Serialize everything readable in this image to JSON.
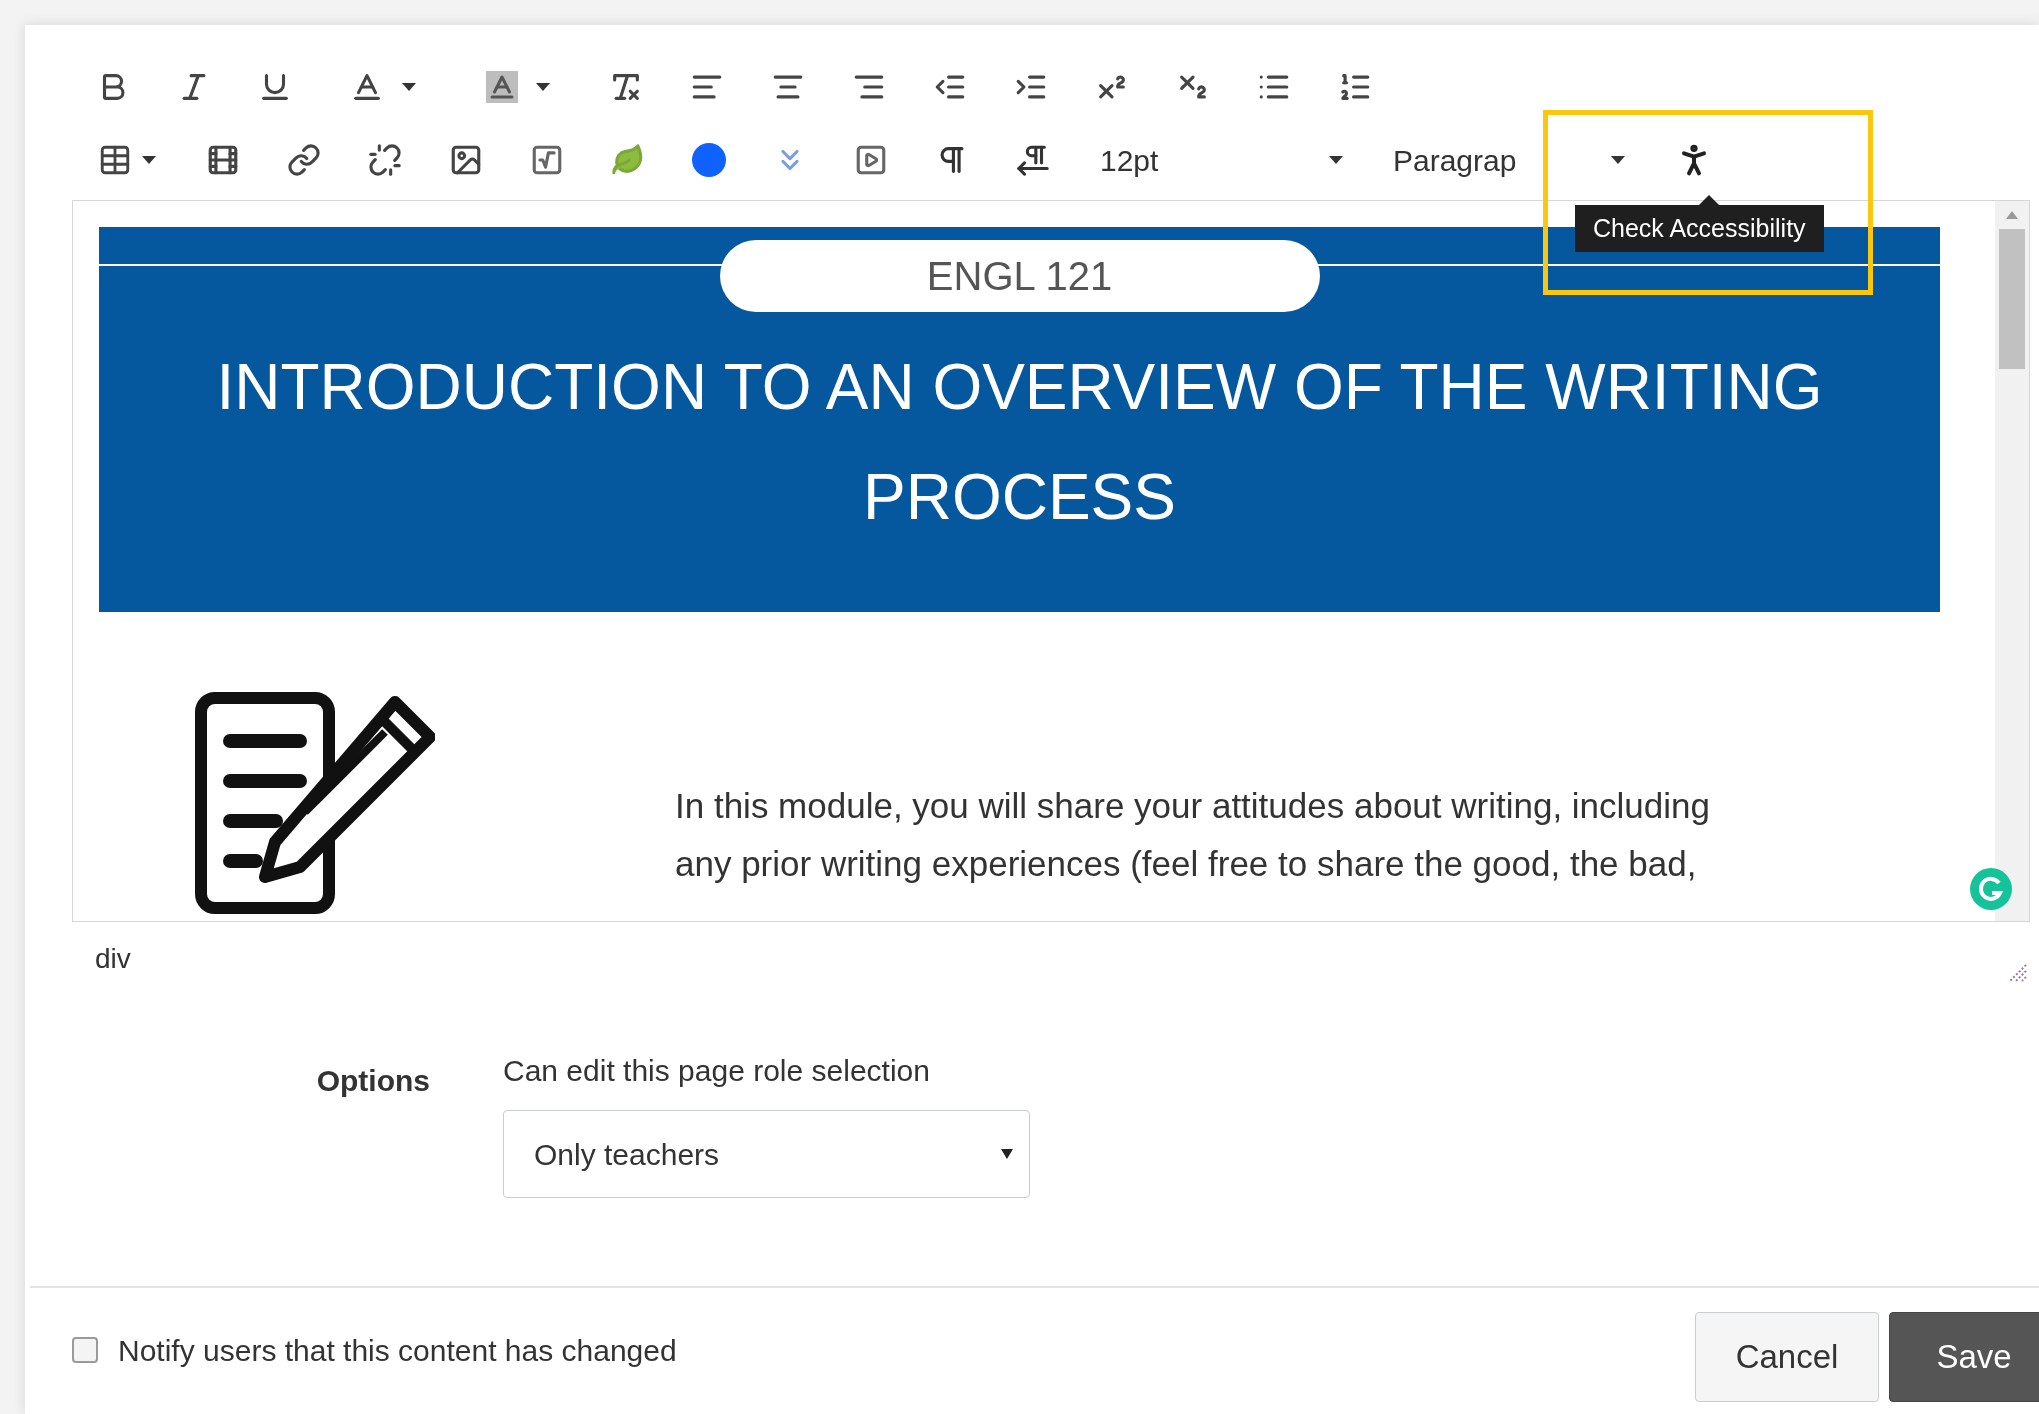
{
  "toolbar": {
    "font_size": "12pt",
    "block_format": "Paragrap"
  },
  "tooltip": {
    "text": "Check Accessibility"
  },
  "editor": {
    "course_code": "ENGL 121",
    "title": "INTRODUCTION TO AN OVERVIEW OF THE WRITING PROCESS",
    "paragraph": "In this module, you will share your attitudes about writing, including any prior writing experiences (feel free to share the good, the bad,"
  },
  "path": "div",
  "options": {
    "label": "Options",
    "field_label": "Can edit this page role selection",
    "select_value": "Only teachers"
  },
  "notify": {
    "label": "Notify users that this content has changed",
    "checked": false
  },
  "buttons": [
    {
      "label": "Cancel",
      "kind": "secondary"
    },
    {
      "label": "Save",
      "kind": "primary"
    }
  ]
}
